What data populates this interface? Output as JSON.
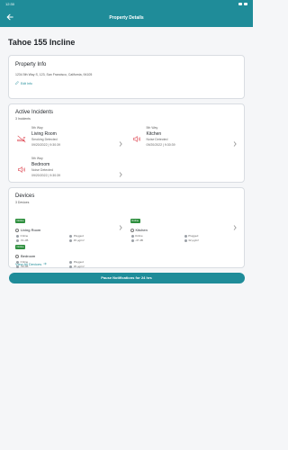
{
  "status_bar": {
    "time": "12:30"
  },
  "app_bar": {
    "title": "Property Details"
  },
  "page": {
    "title": "Tahoe 155 Incline"
  },
  "property_info": {
    "title": "Property Info",
    "address": "1234 5th Way S, 123, San Francisco, California, 94105",
    "edit_label": "Edit Info"
  },
  "incidents": {
    "title": "Active Incidents",
    "count_label": "3 Incidents",
    "items": [
      {
        "floor": "5th Way",
        "room": "Living Room",
        "type": "Smoking Detected",
        "time": "09/20/2022 | 9:30:39",
        "icon": "smoking-icon",
        "color": "#e0505b"
      },
      {
        "floor": "5th Way",
        "room": "Kitchen",
        "type": "Noise Detected",
        "time": "09/20/2022 | 9:30:39",
        "icon": "noise-icon",
        "color": "#e0505b"
      },
      {
        "floor": "5th Way",
        "room": "Bedroom",
        "type": "Noise Detected",
        "time": "09/20/2022 | 9:30:39",
        "icon": "noise-icon",
        "color": "#e0505b"
      }
    ]
  },
  "devices": {
    "title": "Devices",
    "count_label": "3 Devices",
    "view_all_label": "View All Devices",
    "items": [
      {
        "badge": "Online",
        "name": "Living Room",
        "status": "Online",
        "power": "Plugged",
        "signal": "-51 dB",
        "pm": "45 μg/m³"
      },
      {
        "badge": "Online",
        "name": "Kitchen",
        "status": "Online",
        "power": "Plugged",
        "signal": "-47 dB",
        "pm": "32 μg/m³"
      },
      {
        "badge": "Online",
        "name": "Bedroom",
        "status": "Online",
        "power": "Plugged",
        "signal": "-59 dB",
        "pm": "35 μg/m³"
      }
    ]
  },
  "actions": {
    "pause_label": "Pause Notifications for 24 hrs"
  },
  "colors": {
    "primary": "#1f8c99",
    "alert": "#e0505b",
    "online": "#2e8f3e"
  }
}
